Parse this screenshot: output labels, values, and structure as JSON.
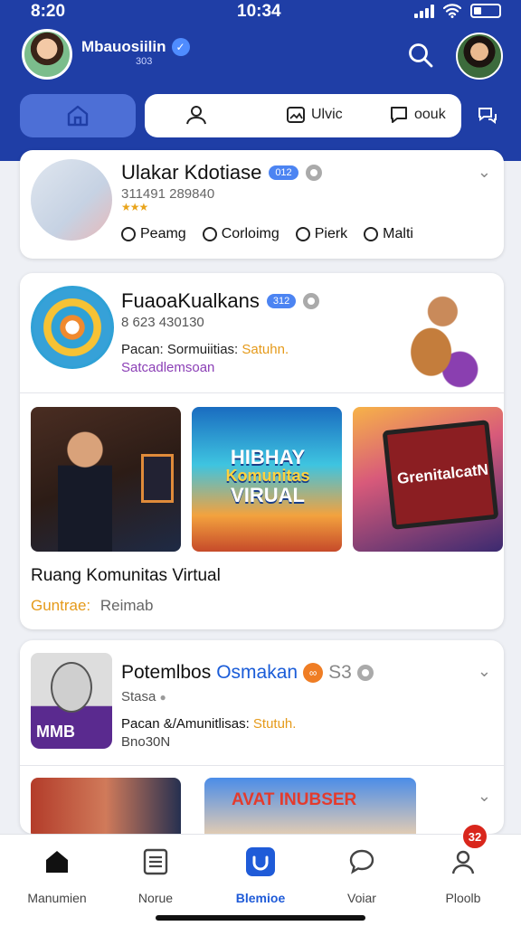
{
  "status_bar": {
    "time_left": "8:20",
    "time_center": "10:34"
  },
  "header": {
    "username": "Mbauosiilin",
    "user_sub": "303",
    "tabs": [
      {
        "label": "Ulvic",
        "icon": "image-icon"
      },
      {
        "label": "oouk",
        "icon": "chat-icon"
      }
    ]
  },
  "cards": [
    {
      "title": "Ulakar Kdotiase",
      "badge": "012",
      "subtitle": "311491 289840",
      "stars": "★★★",
      "actions": [
        "Peamg",
        "Corloimg",
        "Pierk",
        "Malti"
      ]
    },
    {
      "title": "FuaoaKualkans",
      "badge": "312",
      "subtitle": "8 623 430130",
      "line_prefix": "Pacan: Sormuiitias:",
      "line_highlight": "Satuhn.",
      "line2": "Satcadlemsoan",
      "thumb2_line1": "HIBHAY",
      "thumb2_line2": "Komunitas",
      "thumb2_line3": "VIRUAL",
      "thumb3_text": "GrenitalcatN",
      "caption": "Ruang Komunitas Virtual",
      "foot_highlight": "Guntrae:",
      "foot_text": "Reimab"
    },
    {
      "title": "Potemlbos",
      "title_blue": "Osmakan",
      "extra": "S3",
      "subtitle": "Stasa",
      "line_prefix": "Pacan  &/Amunitlisas:",
      "line_highlight": "Stutuh.",
      "line2": "Bno30N",
      "image_label": "MMB",
      "thumb2_text": "AVAT INUBSER"
    }
  ],
  "bottom_nav": [
    {
      "label": "Manumien",
      "icon": "home-icon"
    },
    {
      "label": "Norue",
      "icon": "list-icon"
    },
    {
      "label": "Blemioe",
      "icon": "check-square-icon"
    },
    {
      "label": "Voiar",
      "icon": "chat-bubble-icon"
    },
    {
      "label": "Ploolb",
      "icon": "profile-icon"
    }
  ],
  "notification_count": "32",
  "colors": {
    "header": "#1f3ea6",
    "accent": "#1f5bd8",
    "badge": "#4c84f2",
    "notification": "#d9261c",
    "highlight": "#e59a1a"
  }
}
